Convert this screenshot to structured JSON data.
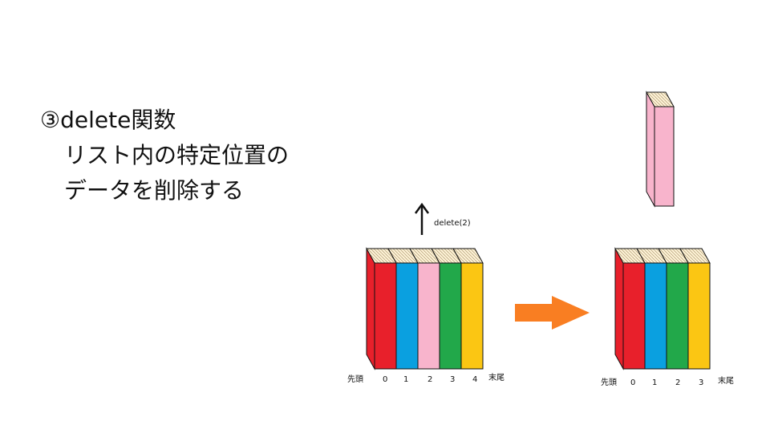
{
  "slide": {
    "heading": "③delete関数",
    "lines": [
      "リスト内の特定位置の",
      "データを削除する"
    ]
  },
  "operation_label": "delete(2)",
  "colors": {
    "red": "#e8202b",
    "blue": "#0aa0e0",
    "pink": "#f8b4cc",
    "green": "#22a84a",
    "yellow": "#fbc613",
    "arrow": "#f97e22",
    "top": "#fdf2d6"
  },
  "before": {
    "head_label": "先頭",
    "tail_label": "末尾",
    "indices": [
      "0",
      "1",
      "2",
      "3",
      "4"
    ],
    "books": [
      "red",
      "blue",
      "pink",
      "green",
      "yellow"
    ]
  },
  "after": {
    "head_label": "先頭",
    "tail_label": "末尾",
    "indices": [
      "0",
      "1",
      "2",
      "3"
    ],
    "books": [
      "red",
      "blue",
      "green",
      "yellow"
    ]
  },
  "removed_book": "pink"
}
